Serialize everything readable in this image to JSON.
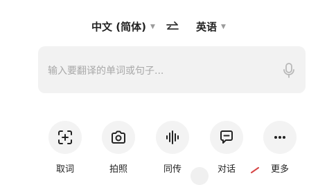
{
  "lang_bar": {
    "source_lang": "中文 (简体)",
    "target_lang": "英语",
    "icons": {
      "swap": "swap-arrows-icon",
      "source_dropdown": "caret-down-icon",
      "target_dropdown": "caret-down-icon"
    }
  },
  "input": {
    "placeholder": "输入要翻译的单词或句子...",
    "icons": {
      "mic": "microphone-icon"
    }
  },
  "tools": [
    {
      "label": "取词",
      "icon": "scan-add-icon"
    },
    {
      "label": "拍照",
      "icon": "camera-icon"
    },
    {
      "label": "同传",
      "icon": "audio-waveform-icon"
    },
    {
      "label": "对话",
      "icon": "chat-bubble-icon"
    },
    {
      "label": "更多",
      "icon": "more-dots-icon"
    }
  ],
  "colors": {
    "background": "#ffffff",
    "input_bg": "#f2f2f2",
    "tool_circle": "#f3f3f3",
    "placeholder": "#a8a8a8",
    "text": "#222222",
    "accent_mark": "#d64545"
  }
}
